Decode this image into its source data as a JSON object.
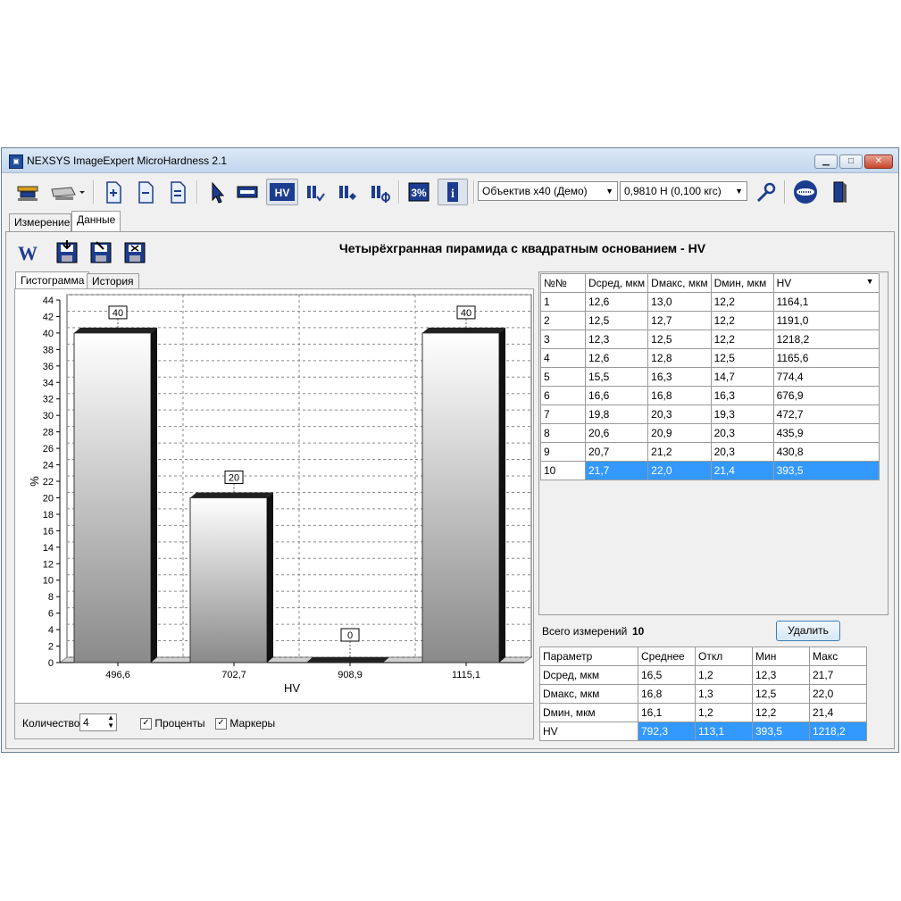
{
  "window": {
    "title": "NEXSYS ImageExpert MicroHardness 2.1"
  },
  "toolbar": {
    "objective": "Объектив x40 (Демо)",
    "load": "0,9810 Н   (0,100 кгс)",
    "hv_label": "HV",
    "percent_label": "3%",
    "info_label": "i"
  },
  "tabs": {
    "measure": "Измерение",
    "data": "Данные"
  },
  "data_panel": {
    "title": "Четырёхгранная пирамида с квадратным основанием - HV",
    "word_label": "W",
    "subtabs": {
      "histogram": "Гистограмма",
      "history": "История"
    }
  },
  "chart_data": {
    "type": "bar",
    "categories": [
      "496,6",
      "702,7",
      "908,9",
      "1115,1"
    ],
    "values": [
      40,
      20,
      0,
      40
    ],
    "data_labels": [
      "40",
      "20",
      "0",
      "40"
    ],
    "xlabel": "HV",
    "ylabel": "%",
    "ylim": [
      0,
      44
    ],
    "yticks": [
      "0",
      "2",
      "4",
      "6",
      "8",
      "10",
      "12",
      "14",
      "16",
      "18",
      "20",
      "22",
      "24",
      "26",
      "28",
      "30",
      "32",
      "34",
      "36",
      "38",
      "40",
      "42",
      "44"
    ],
    "grid": true
  },
  "controls": {
    "count_label": "Количество",
    "count_value": "4",
    "percent_label": "Проценты",
    "percent_checked": "✓",
    "markers_label": "Маркеры",
    "markers_checked": "✓"
  },
  "measurements": {
    "headers": [
      "№№",
      "Dсред, мкм",
      "Dмакс, мкм",
      "Dмин, мкм",
      "HV"
    ],
    "rows": [
      [
        "1",
        "12,6",
        "13,0",
        "12,2",
        "1164,1"
      ],
      [
        "2",
        "12,5",
        "12,7",
        "12,2",
        "1191,0"
      ],
      [
        "3",
        "12,3",
        "12,5",
        "12,2",
        "1218,2"
      ],
      [
        "4",
        "12,6",
        "12,8",
        "12,5",
        "1165,6"
      ],
      [
        "5",
        "15,5",
        "16,3",
        "14,7",
        "774,4"
      ],
      [
        "6",
        "16,6",
        "16,8",
        "16,3",
        "676,9"
      ],
      [
        "7",
        "19,8",
        "20,3",
        "19,3",
        "472,7"
      ],
      [
        "8",
        "20,6",
        "20,9",
        "20,3",
        "435,9"
      ],
      [
        "9",
        "20,7",
        "21,2",
        "20,3",
        "430,8"
      ],
      [
        "10",
        "21,7",
        "22,0",
        "21,4",
        "393,5"
      ]
    ]
  },
  "summary": {
    "total_label": "Всего измерений",
    "total_value": "10",
    "delete_label": "Удалить"
  },
  "stats": {
    "headers": [
      "Параметр",
      "Среднее",
      "Откл",
      "Мин",
      "Макс"
    ],
    "rows": [
      [
        "Dсред, мкм",
        "16,5",
        "1,2",
        "12,3",
        "21,7"
      ],
      [
        "Dмакс, мкм",
        "16,8",
        "1,3",
        "12,5",
        "22,0"
      ],
      [
        "Dмин, мкм",
        "16,1",
        "1,2",
        "12,2",
        "21,4"
      ],
      [
        "HV",
        "792,3",
        "113,1",
        "393,5",
        "1218,2"
      ]
    ]
  }
}
